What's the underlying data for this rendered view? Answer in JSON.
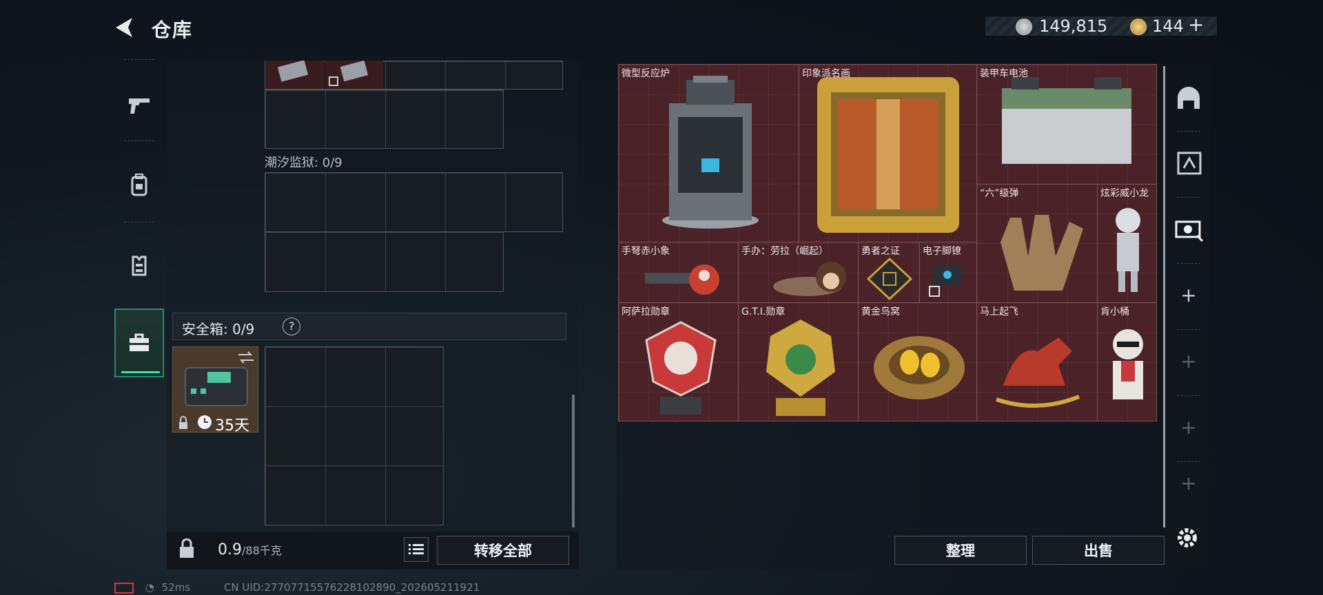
{
  "header": {
    "title": "仓库"
  },
  "currency": {
    "silver": "149,815",
    "gold": "144",
    "add_label": "+"
  },
  "left_nav": {
    "items": [
      "weapon",
      "backpack",
      "vest",
      "safe-box"
    ],
    "active": "safe-box"
  },
  "containers": {
    "tide_prison_label": "潮汐监狱: 0/9",
    "safe_box_label": "安全箱: 0/9",
    "safe_box_help": "?",
    "safe_box_days": "35天"
  },
  "bottom": {
    "weight_value": "0.9",
    "weight_capacity": "/88千克",
    "transfer_all": "转移全部",
    "sort": "整理",
    "sell": "出售"
  },
  "stash_items": [
    {
      "name": "微型反应炉"
    },
    {
      "name": "印象派名画"
    },
    {
      "name": "装甲车电池"
    },
    {
      "name": "“六”级弹"
    },
    {
      "name": "炫彩威小龙"
    },
    {
      "name": "手弩赤小象"
    },
    {
      "name": "手办：劳拉（崛起）"
    },
    {
      "name": "勇者之证"
    },
    {
      "name": "电子脚镣"
    },
    {
      "name": "阿萨拉勋章"
    },
    {
      "name": "G.T.I.勋章"
    },
    {
      "name": "黄金鸟窝"
    },
    {
      "name": "马上起飞"
    },
    {
      "name": "肯小桶"
    }
  ],
  "right_nav": {
    "items": [
      "helmet-tab",
      "stash-iv-tab",
      "stash-iv-alt-tab",
      "add",
      "add",
      "add",
      "add"
    ],
    "add_label": "+"
  },
  "footer": {
    "ping": "52ms",
    "uid": "CN UID:27707715576228102890_202605211921"
  },
  "colors": {
    "stash_bg": "#4a2228",
    "accent": "#3ee0b0"
  }
}
